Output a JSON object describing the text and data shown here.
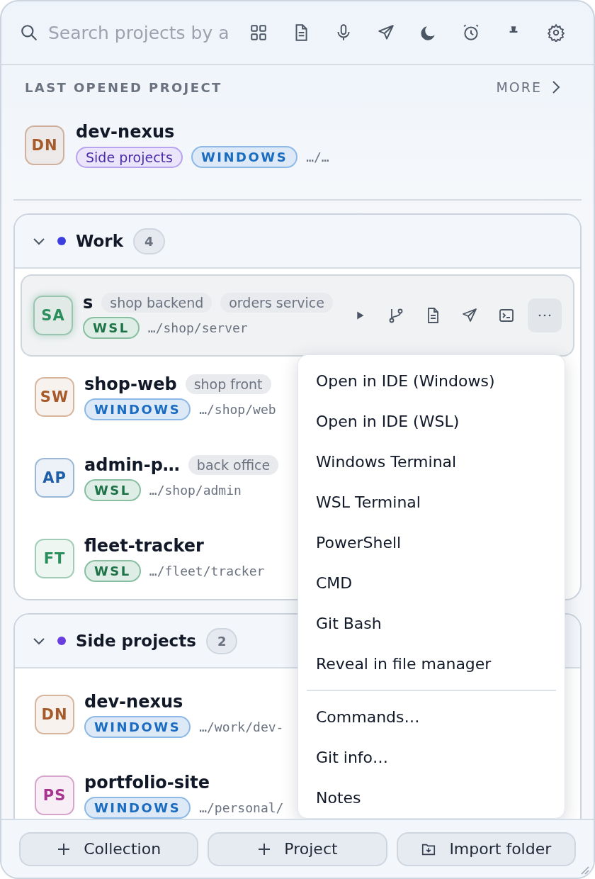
{
  "search": {
    "placeholder": "Search projects by a"
  },
  "last_opened": {
    "heading": "LAST OPENED PROJECT",
    "more": "MORE",
    "project": {
      "initials": "DN",
      "color": "#a65a2a",
      "name": "dev-nexus",
      "collection": "Side projects",
      "env": {
        "kind": "windows",
        "label": "WINDOWS"
      },
      "path": "…/…"
    }
  },
  "groups": [
    {
      "name": "Work",
      "color": "#3b3fe0",
      "count": "4",
      "expanded": true,
      "projects": [
        {
          "initials": "SA",
          "color": "#2a8f5c",
          "name": "s",
          "tags": [
            "shop backend",
            "orders service"
          ],
          "env": {
            "kind": "wsl",
            "label": "WSL"
          },
          "path": "…/shop/server",
          "selected": true
        },
        {
          "initials": "SW",
          "color": "#a65a2a",
          "name": "shop-web",
          "tags": [
            "shop front"
          ],
          "env": {
            "kind": "windows",
            "label": "WINDOWS"
          },
          "path": "…/shop/web",
          "selected": false
        },
        {
          "initials": "AP",
          "color": "#1e5fa8",
          "name": "admin-p…",
          "tags": [
            "back office"
          ],
          "env": {
            "kind": "wsl",
            "label": "WSL"
          },
          "path": "…/shop/admin",
          "selected": false
        },
        {
          "initials": "FT",
          "color": "#2a8f5c",
          "name": "fleet-tracker",
          "env": {
            "kind": "wsl",
            "label": "WSL"
          },
          "path": "…/fleet/tracker",
          "selected": false
        }
      ]
    },
    {
      "name": "Side projects",
      "color": "#6a3de0",
      "count": "2",
      "expanded": true,
      "projects": [
        {
          "initials": "DN",
          "color": "#a65a2a",
          "name": "dev-nexus",
          "env": {
            "kind": "windows",
            "label": "WINDOWS"
          },
          "path": "…/work/dev-",
          "selected": false
        },
        {
          "initials": "PS",
          "color": "#a8348f",
          "name": "portfolio-site",
          "env": {
            "kind": "windows",
            "label": "WINDOWS"
          },
          "path": "…/personal/",
          "selected": false
        }
      ]
    }
  ],
  "menu": {
    "sections": [
      [
        "Open in IDE (Windows)",
        "Open in IDE (WSL)",
        "Windows Terminal",
        "WSL Terminal",
        "PowerShell",
        "CMD",
        "Git Bash",
        "Reveal in file manager"
      ],
      [
        "Commands…",
        "Git info…",
        "Notes"
      ]
    ]
  },
  "footer": {
    "buttons": [
      {
        "kind": "add",
        "label": "Collection"
      },
      {
        "kind": "add",
        "label": "Project"
      },
      {
        "kind": "import",
        "label": "Import folder"
      }
    ]
  }
}
